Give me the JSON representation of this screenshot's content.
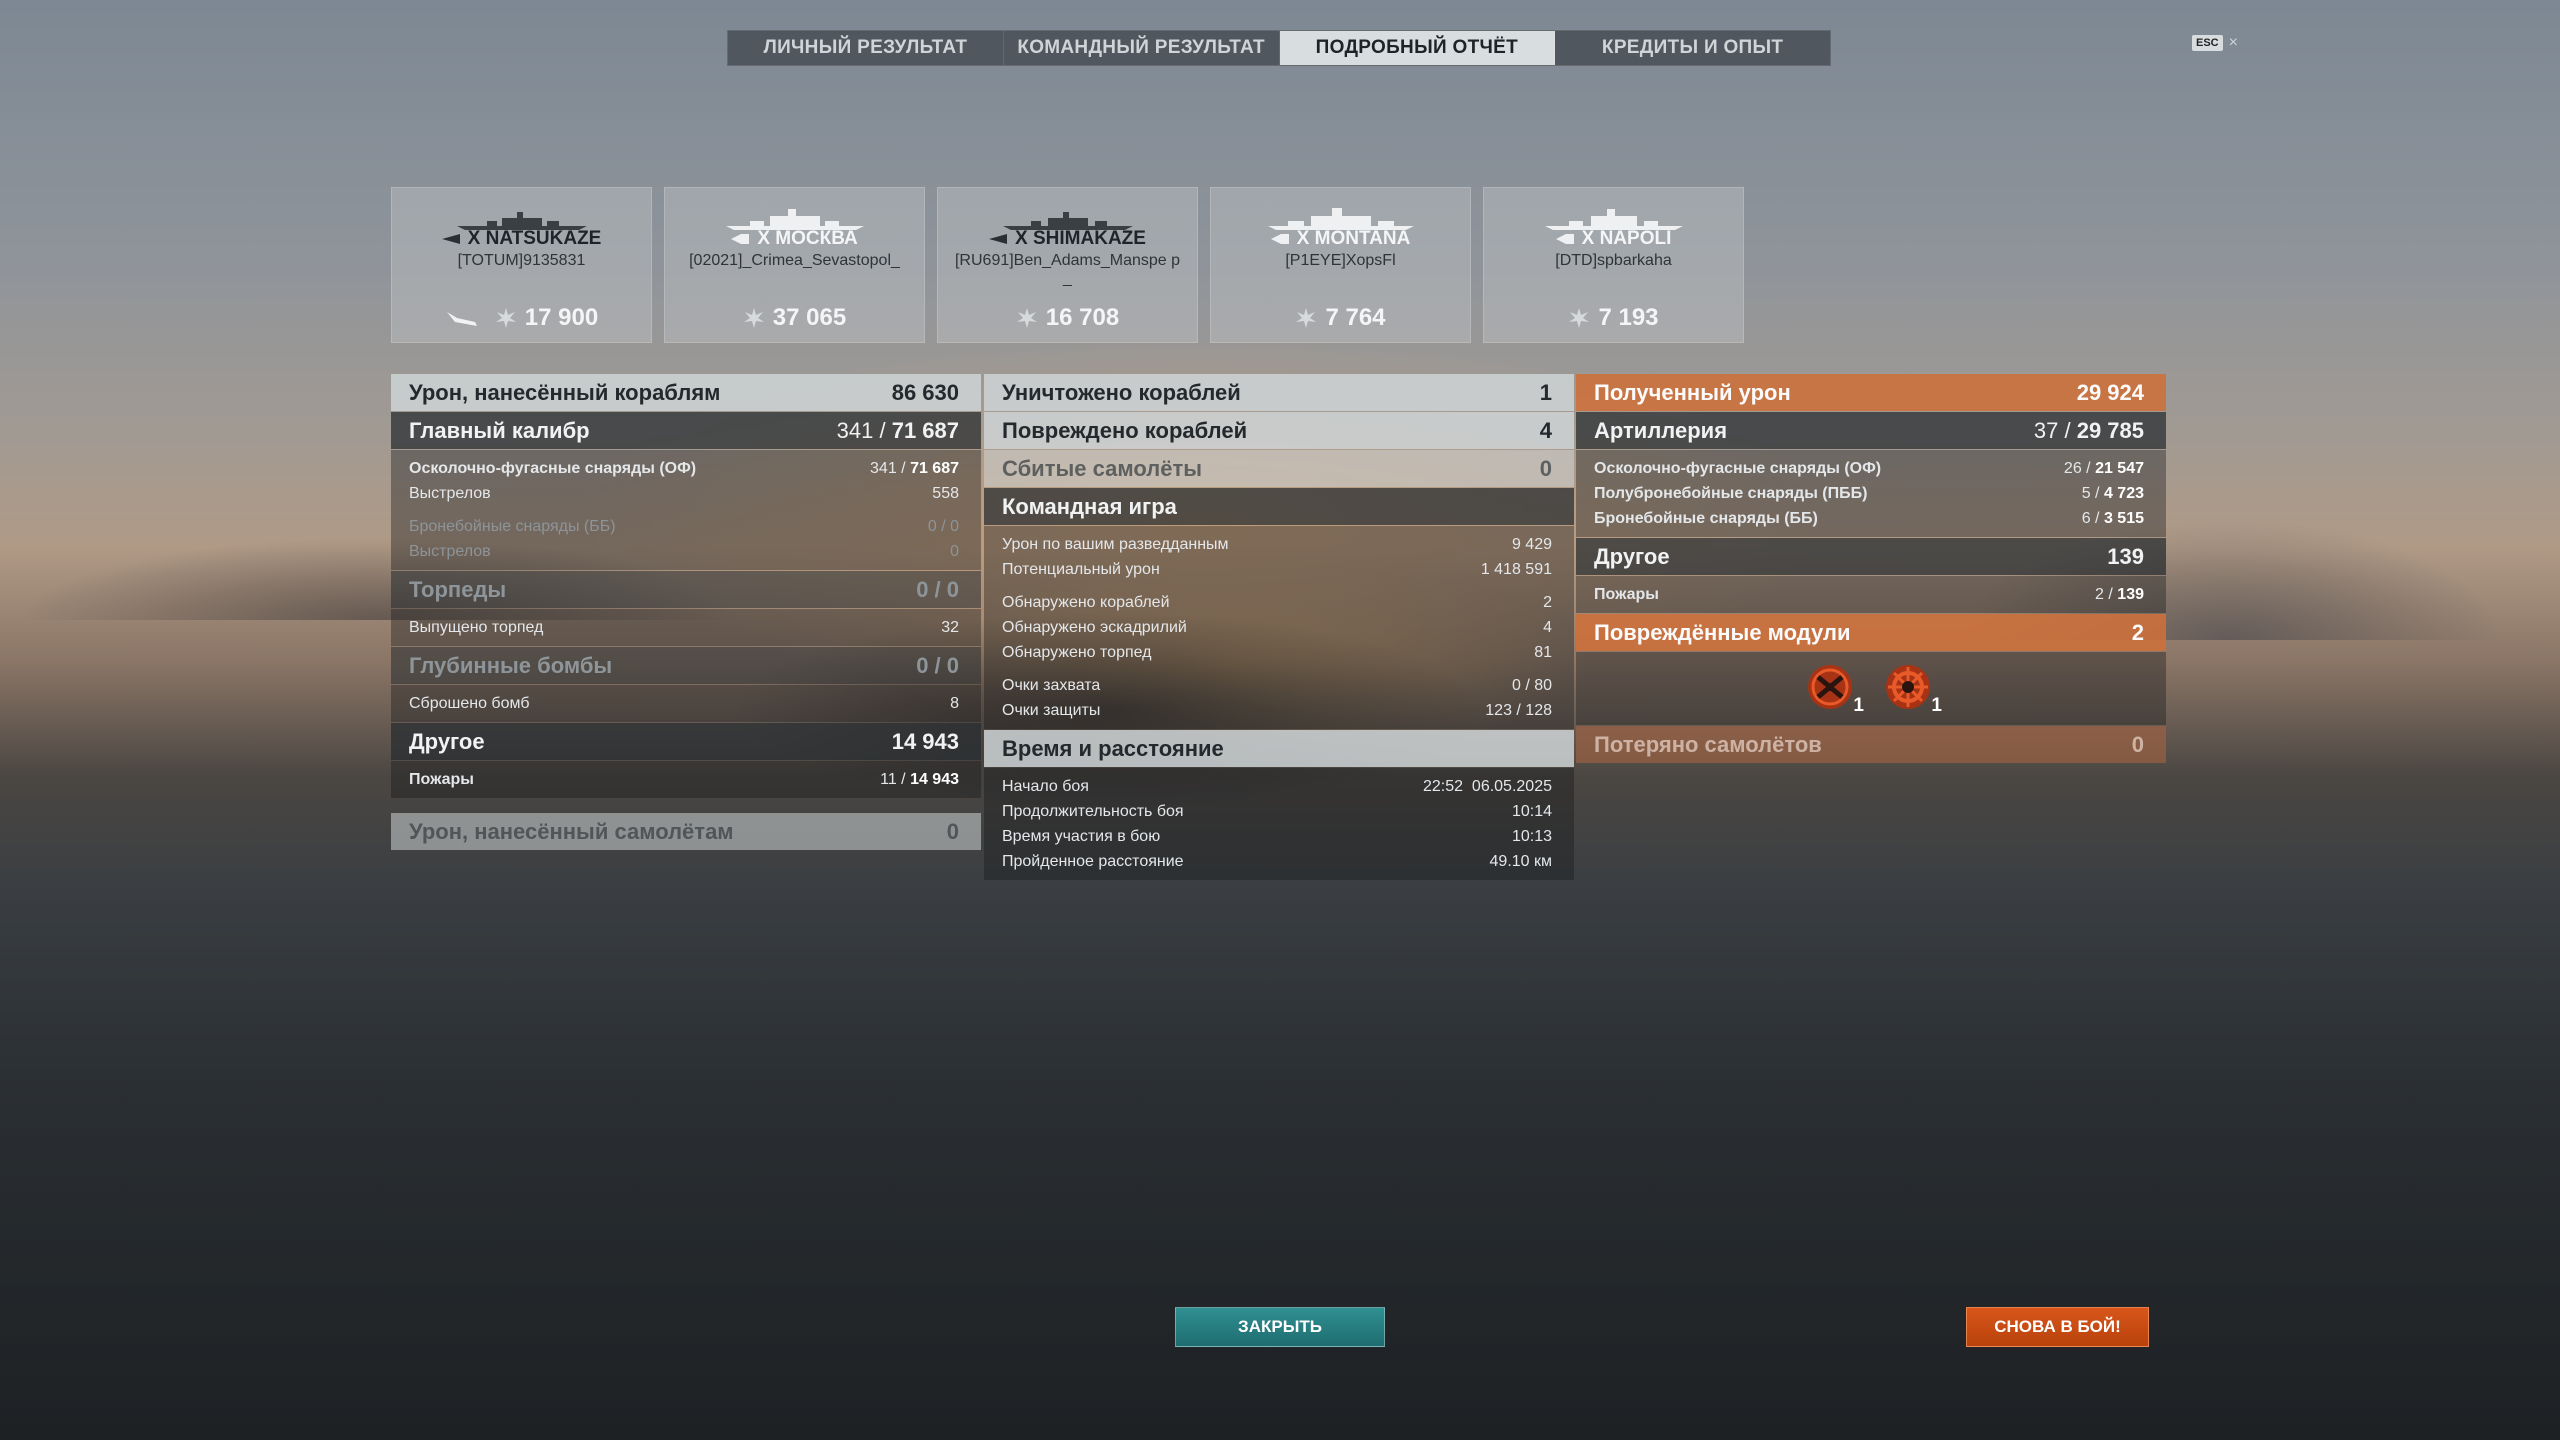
{
  "tabs": [
    {
      "label": "ЛИЧНЫЙ РЕЗУЛЬТАТ",
      "active": false
    },
    {
      "label": "КОМАНДНЫЙ РЕЗУЛЬТАТ",
      "active": false
    },
    {
      "label": "ПОДРОБНЫЙ ОТЧЁТ",
      "active": true
    },
    {
      "label": "КРЕДИТЫ И ОПЫТ",
      "active": false
    }
  ],
  "esc": {
    "key": "ESC",
    "close": "×"
  },
  "ships": [
    {
      "tier_name": "X NATSUKAZE",
      "player": "[TOTUM]9135831",
      "damage": "17 900",
      "has_plane": true
    },
    {
      "tier_name": "X МОСКВА",
      "player": "[02021]_Crimea_Sevastopol_",
      "damage": "37 065",
      "has_plane": false
    },
    {
      "tier_name": "X SHIMAKAZE",
      "player": "[RU691]Ben_Adams_Manspe p_",
      "damage": "16 708",
      "has_plane": false
    },
    {
      "tier_name": "X MONTANA",
      "player": "[P1EYE]XopsFl",
      "damage": "7 764",
      "has_plane": false
    },
    {
      "tier_name": "X NAPOLI",
      "player": "[DTD]spbarkaha",
      "damage": "7 193",
      "has_plane": false
    }
  ],
  "left": {
    "ship_damage": {
      "label": "Урон, нанесённый кораблям",
      "value": "86 630"
    },
    "main_caliber": {
      "label": "Главный калибр",
      "hits": "341",
      "damage": "71 687"
    },
    "he": {
      "label": "Осколочно-фугасные снаряды (ОФ)",
      "hits": "341",
      "damage": "71 687"
    },
    "he_shots": {
      "label": "Выстрелов",
      "value": "558"
    },
    "ap": {
      "label": "Бронебойные снаряды (ББ)",
      "value": "0 / 0"
    },
    "ap_shots": {
      "label": "Выстрелов",
      "value": "0"
    },
    "torpedoes": {
      "label": "Торпеды",
      "value": "0 / 0"
    },
    "torps_launched": {
      "label": "Выпущено торпед",
      "value": "32"
    },
    "depth": {
      "label": "Глубинные бомбы",
      "value": "0 / 0"
    },
    "bombs_dropped": {
      "label": "Сброшено бомб",
      "value": "8"
    },
    "other": {
      "label": "Другое",
      "value": "14 943"
    },
    "fires": {
      "label": "Пожары",
      "hits": "11",
      "damage": "14 943"
    },
    "plane_damage": {
      "label": "Урон, нанесённый самолётам",
      "value": "0"
    }
  },
  "mid": {
    "destroyed": {
      "label": "Уничтожено кораблей",
      "value": "1"
    },
    "damaged": {
      "label": "Повреждено кораблей",
      "value": "4"
    },
    "planes_shot": {
      "label": "Сбитые самолёты",
      "value": "0"
    },
    "team_play": {
      "label": "Командная игра"
    },
    "team_rows": [
      {
        "label": "Урон по вашим разведданным",
        "value": "9 429"
      },
      {
        "label": "Потенциальный урон",
        "value": "1 418 591"
      }
    ],
    "spot_rows": [
      {
        "label": "Обнаружено кораблей",
        "value": "2"
      },
      {
        "label": "Обнаружено эскадрилий",
        "value": "4"
      },
      {
        "label": "Обнаружено торпед",
        "value": "81"
      }
    ],
    "cap_rows": [
      {
        "label": "Очки захвата",
        "value": "0 / 80"
      },
      {
        "label": "Очки защиты",
        "value": "123 / 128"
      }
    ],
    "time_dist": {
      "label": "Время и расстояние"
    },
    "time_rows": [
      {
        "label": "Начало боя",
        "value": "22:52  06.05.2025"
      },
      {
        "label": "Продолжительность боя",
        "value": "10:14"
      },
      {
        "label": "Время участия в бою",
        "value": "10:13"
      },
      {
        "label": "Пройденное расстояние",
        "value": "49.10 км"
      }
    ]
  },
  "right": {
    "received": {
      "label": "Полученный урон",
      "value": "29 924"
    },
    "artillery": {
      "label": "Артиллерия",
      "hits": "37",
      "damage": "29 785"
    },
    "rec_he": {
      "label": "Осколочно-фугасные снаряды (ОФ)",
      "hits": "26",
      "damage": "21 547"
    },
    "rec_sap": {
      "label": "Полубронебойные снаряды (ПББ)",
      "hits": "5",
      "damage": "4 723"
    },
    "rec_ap": {
      "label": "Бронебойные снаряды (ББ)",
      "hits": "6",
      "damage": "3 515"
    },
    "other": {
      "label": "Другое",
      "value": "139"
    },
    "fires": {
      "label": "Пожары",
      "hits": "2",
      "damage": "139"
    },
    "modules": {
      "label": "Повреждённые модули",
      "value": "2"
    },
    "module_items": [
      {
        "icon": "propeller-damaged-icon",
        "count": "1"
      },
      {
        "icon": "steering-gear-damaged-icon",
        "count": "1"
      }
    ],
    "planes_lost": {
      "label": "Потеряно самолётов",
      "value": "0"
    }
  },
  "buttons": {
    "close": "ЗАКРЫТЬ",
    "battle_again": "СНОВА В БОЙ!"
  },
  "colors": {
    "accent_orange": "#ce703a",
    "close_button": "#2f8f91",
    "battle_button": "#d8561a"
  }
}
